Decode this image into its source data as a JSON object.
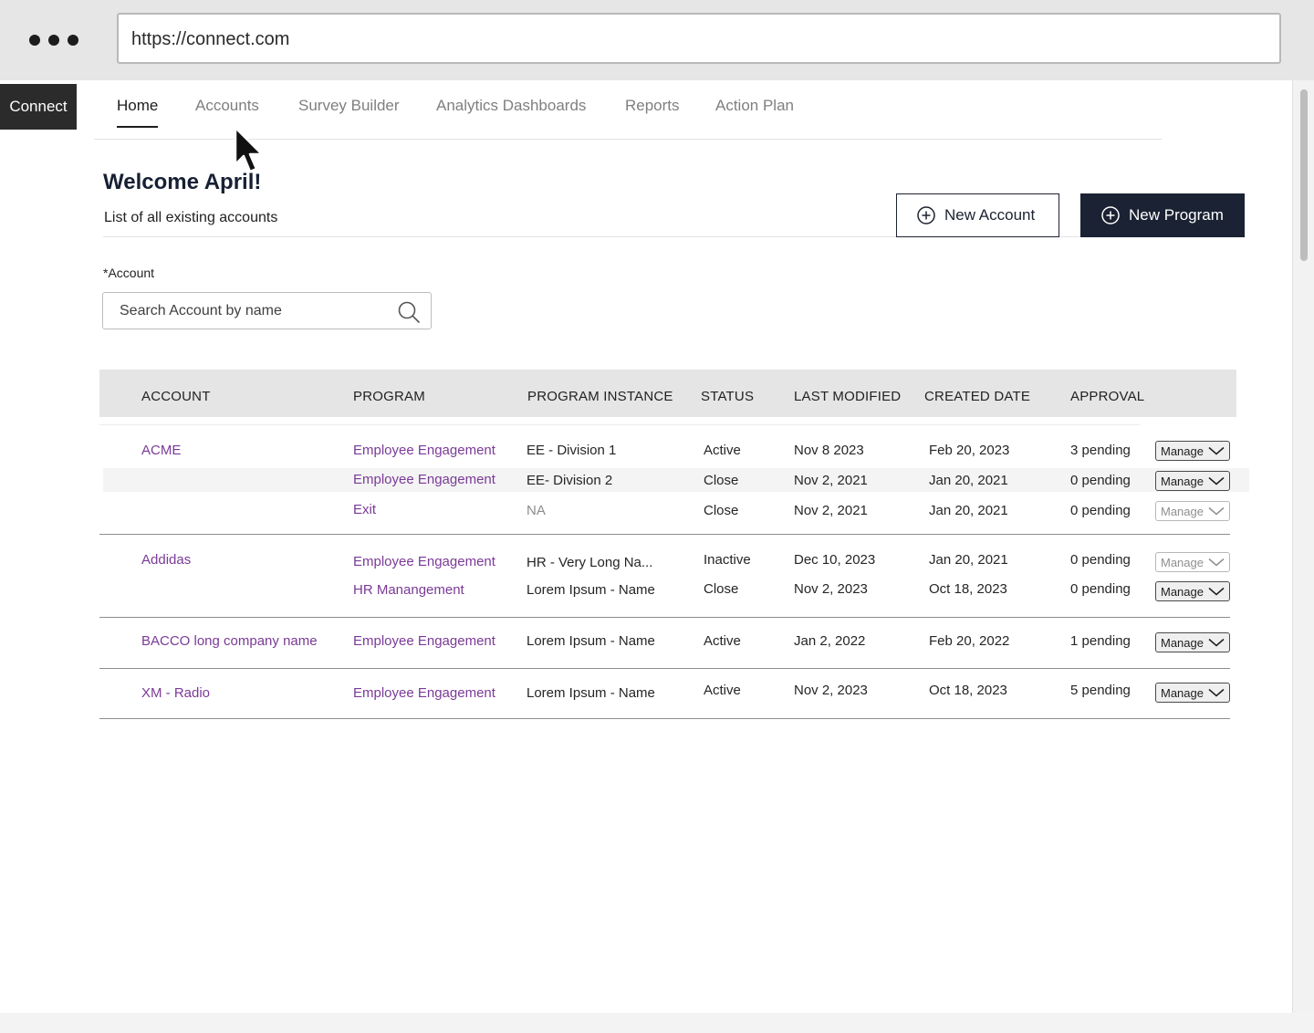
{
  "browser": {
    "url": "https://connect.com"
  },
  "app": {
    "logo": "Connect"
  },
  "nav": {
    "tabs": [
      "Home",
      "Accounts",
      "Survey Builder",
      "Analytics Dashboards",
      "Reports",
      "Action Plan"
    ],
    "active": "Home"
  },
  "header": {
    "title": "Welcome April!",
    "subtitle": "List of all existing accounts",
    "new_account_label": "New Account",
    "new_program_label": "New Program"
  },
  "search": {
    "label": "*Account",
    "placeholder": "Search Account by name"
  },
  "table": {
    "columns": [
      "ACCOUNT",
      "PROGRAM",
      "PROGRAM INSTANCE",
      "STATUS",
      "LAST MODIFIED",
      "CREATED DATE",
      "APPROVAL"
    ],
    "manage_label": "Manage",
    "rows": [
      {
        "account": "ACME",
        "program": "Employee Engagement",
        "instance": "EE - Division 1",
        "status": "Active",
        "last_modified": "Nov 8 2023",
        "created": "Feb 20, 2023",
        "approval": "3 pending",
        "manage_enabled": true
      },
      {
        "account": "",
        "program": "Employee Engagement",
        "instance": "EE- Division 2",
        "status": "Close",
        "last_modified": "Nov 2, 2021",
        "created": "Jan 20, 2021",
        "approval": "0 pending",
        "manage_enabled": true
      },
      {
        "account": "",
        "program": "Exit",
        "instance": "NA",
        "status": "Close",
        "last_modified": "Nov 2, 2021",
        "created": "Jan 20, 2021",
        "approval": "0 pending",
        "manage_enabled": false
      },
      {
        "account": "Addidas",
        "program": "Employee Engagement",
        "instance": "HR - Very Long Na...",
        "status": "Inactive",
        "last_modified": "Dec 10, 2023",
        "created": "Jan 20, 2021",
        "approval": "0 pending",
        "manage_enabled": false
      },
      {
        "account": "",
        "program": "HR Manangement",
        "instance": "Lorem Ipsum - Name",
        "status": "Close",
        "last_modified": "Nov 2, 2023",
        "created": "Oct 18, 2023",
        "approval": "0 pending",
        "manage_enabled": true
      },
      {
        "account": "BACCO long company name",
        "program": "Employee Engagement",
        "instance": "Lorem Ipsum - Name",
        "status": "Active",
        "last_modified": "Jan 2, 2022",
        "created": "Feb 20, 2022",
        "approval": "1 pending",
        "manage_enabled": true
      },
      {
        "account": "XM - Radio",
        "program": "Employee Engagement",
        "instance": "Lorem Ipsum - Name",
        "status": "Active",
        "last_modified": "Nov 2, 2023",
        "created": "Oct 18, 2023",
        "approval": "5 pending",
        "manage_enabled": true
      }
    ]
  },
  "colors": {
    "link": "#7a3a97",
    "primary": "#1a2233",
    "header_bg": "#e5e5e5"
  },
  "icons": [
    "more-dots-icon",
    "plus-circle-icon",
    "search-icon",
    "chevron-down-icon",
    "mouse-cursor-icon"
  ]
}
